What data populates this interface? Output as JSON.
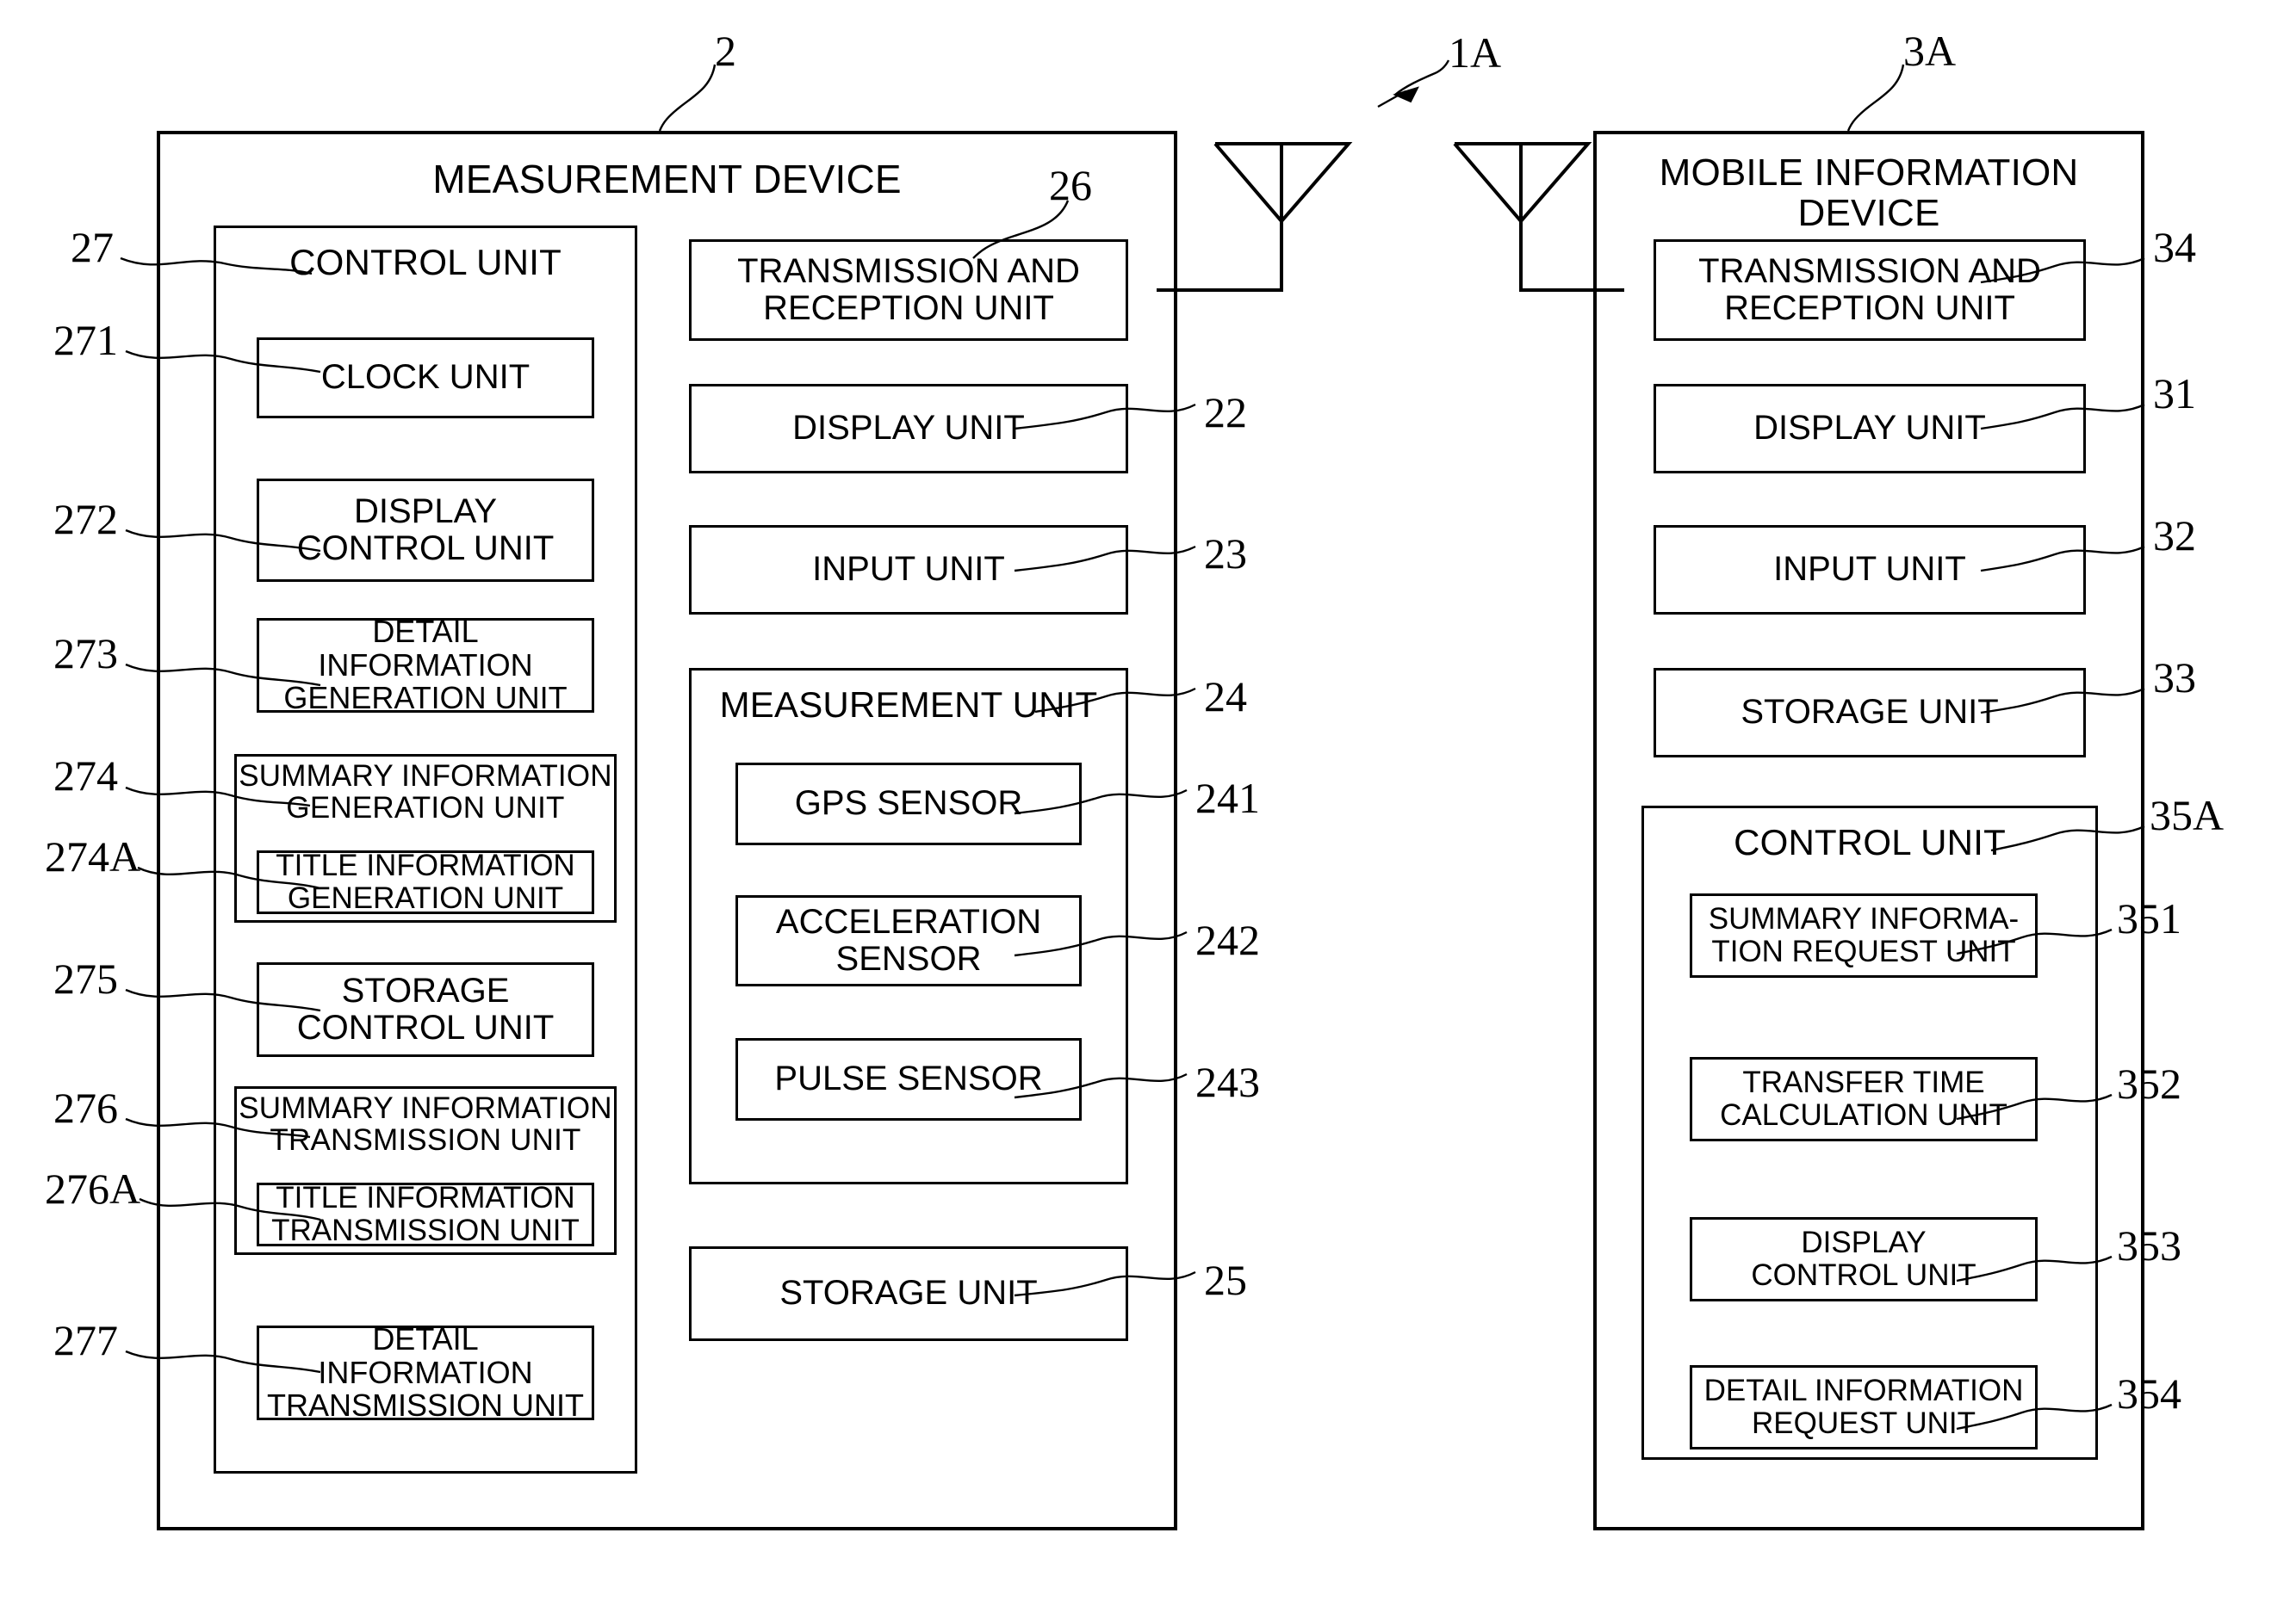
{
  "figure": {
    "system_ref": "1A",
    "measurement_device": {
      "ref": "2",
      "title": "MEASUREMENT DEVICE",
      "control_unit": {
        "ref": "27",
        "title": "CONTROL UNIT",
        "items": [
          {
            "ref": "271",
            "label": "CLOCK UNIT"
          },
          {
            "ref": "272",
            "label": "DISPLAY\nCONTROL UNIT"
          },
          {
            "ref": "273",
            "label": "DETAIL INFORMATION\nGENERATION UNIT"
          },
          {
            "ref": "274",
            "label": "SUMMARY INFORMATION\nGENERATION UNIT",
            "nested": {
              "ref": "274A",
              "label": "TITLE INFORMATION\nGENERATION UNIT"
            }
          },
          {
            "ref": "275",
            "label": "STORAGE\nCONTROL UNIT"
          },
          {
            "ref": "276",
            "label": "SUMMARY INFORMATION\nTRANSMISSION UNIT",
            "nested": {
              "ref": "276A",
              "label": "TITLE INFORMATION\nTRANSMISSION UNIT"
            }
          },
          {
            "ref": "277",
            "label": "DETAIL INFORMATION\nTRANSMISSION UNIT"
          }
        ]
      },
      "modules": [
        {
          "ref": "26",
          "label": "TRANSMISSION AND\nRECEPTION UNIT"
        },
        {
          "ref": "22",
          "label": "DISPLAY UNIT"
        },
        {
          "ref": "23",
          "label": "INPUT UNIT"
        },
        {
          "ref": "25",
          "label": "STORAGE UNIT"
        }
      ],
      "measurement_unit": {
        "ref": "24",
        "title": "MEASUREMENT UNIT",
        "sensors": [
          {
            "ref": "241",
            "label": "GPS SENSOR"
          },
          {
            "ref": "242",
            "label": "ACCELERATION\nSENSOR"
          },
          {
            "ref": "243",
            "label": "PULSE SENSOR"
          }
        ]
      }
    },
    "mobile_information_device": {
      "ref": "3A",
      "title": "MOBILE INFORMATION\nDEVICE",
      "modules": [
        {
          "ref": "34",
          "label": "TRANSMISSION AND\nRECEPTION UNIT"
        },
        {
          "ref": "31",
          "label": "DISPLAY UNIT"
        },
        {
          "ref": "32",
          "label": "INPUT UNIT"
        },
        {
          "ref": "33",
          "label": "STORAGE UNIT"
        }
      ],
      "control_unit": {
        "ref": "35A",
        "title": "CONTROL UNIT",
        "items": [
          {
            "ref": "351",
            "label": "SUMMARY INFORMA-\nTION REQUEST UNIT"
          },
          {
            "ref": "352",
            "label": "TRANSFER TIME\nCALCULATION UNIT"
          },
          {
            "ref": "353",
            "label": "DISPLAY\nCONTROL UNIT"
          },
          {
            "ref": "354",
            "label": "DETAIL INFORMATION\nREQUEST UNIT"
          }
        ]
      }
    },
    "antennas": [
      {
        "name": "measurement-device-antenna"
      },
      {
        "name": "mobile-device-antenna"
      }
    ]
  }
}
